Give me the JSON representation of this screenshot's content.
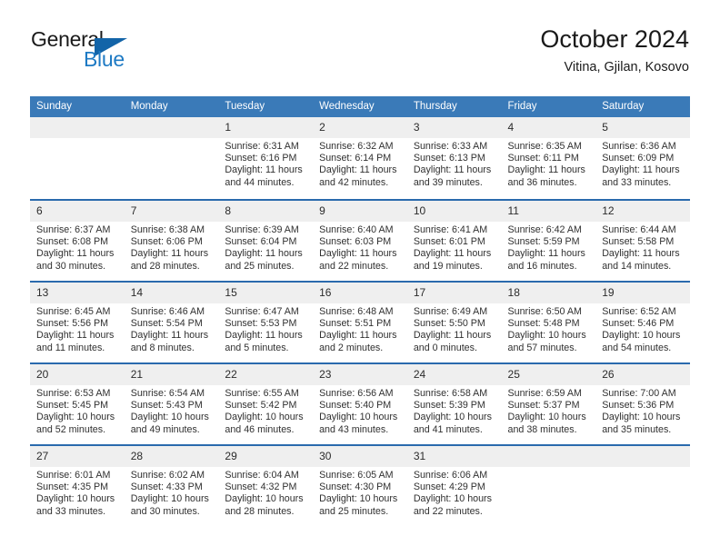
{
  "brand": {
    "word1": "General",
    "word2": "Blue",
    "triangle_color": "#1364a8",
    "blue_text_color": "#1e7ac4"
  },
  "header": {
    "title": "October 2024",
    "subtitle": "Vitina, Gjilan, Kosovo"
  },
  "theme": {
    "header_blue": "#3a7ab8",
    "row_divider_blue": "#2a6aad",
    "daynum_band": "#efefef"
  },
  "weekdays": [
    "Sunday",
    "Monday",
    "Tuesday",
    "Wednesday",
    "Thursday",
    "Friday",
    "Saturday"
  ],
  "weeks": [
    [
      {
        "day": ""
      },
      {
        "day": ""
      },
      {
        "day": "1",
        "sunrise": "Sunrise: 6:31 AM",
        "sunset": "Sunset: 6:16 PM",
        "daylight1": "Daylight: 11 hours",
        "daylight2": "and 44 minutes."
      },
      {
        "day": "2",
        "sunrise": "Sunrise: 6:32 AM",
        "sunset": "Sunset: 6:14 PM",
        "daylight1": "Daylight: 11 hours",
        "daylight2": "and 42 minutes."
      },
      {
        "day": "3",
        "sunrise": "Sunrise: 6:33 AM",
        "sunset": "Sunset: 6:13 PM",
        "daylight1": "Daylight: 11 hours",
        "daylight2": "and 39 minutes."
      },
      {
        "day": "4",
        "sunrise": "Sunrise: 6:35 AM",
        "sunset": "Sunset: 6:11 PM",
        "daylight1": "Daylight: 11 hours",
        "daylight2": "and 36 minutes."
      },
      {
        "day": "5",
        "sunrise": "Sunrise: 6:36 AM",
        "sunset": "Sunset: 6:09 PM",
        "daylight1": "Daylight: 11 hours",
        "daylight2": "and 33 minutes."
      }
    ],
    [
      {
        "day": "6",
        "sunrise": "Sunrise: 6:37 AM",
        "sunset": "Sunset: 6:08 PM",
        "daylight1": "Daylight: 11 hours",
        "daylight2": "and 30 minutes."
      },
      {
        "day": "7",
        "sunrise": "Sunrise: 6:38 AM",
        "sunset": "Sunset: 6:06 PM",
        "daylight1": "Daylight: 11 hours",
        "daylight2": "and 28 minutes."
      },
      {
        "day": "8",
        "sunrise": "Sunrise: 6:39 AM",
        "sunset": "Sunset: 6:04 PM",
        "daylight1": "Daylight: 11 hours",
        "daylight2": "and 25 minutes."
      },
      {
        "day": "9",
        "sunrise": "Sunrise: 6:40 AM",
        "sunset": "Sunset: 6:03 PM",
        "daylight1": "Daylight: 11 hours",
        "daylight2": "and 22 minutes."
      },
      {
        "day": "10",
        "sunrise": "Sunrise: 6:41 AM",
        "sunset": "Sunset: 6:01 PM",
        "daylight1": "Daylight: 11 hours",
        "daylight2": "and 19 minutes."
      },
      {
        "day": "11",
        "sunrise": "Sunrise: 6:42 AM",
        "sunset": "Sunset: 5:59 PM",
        "daylight1": "Daylight: 11 hours",
        "daylight2": "and 16 minutes."
      },
      {
        "day": "12",
        "sunrise": "Sunrise: 6:44 AM",
        "sunset": "Sunset: 5:58 PM",
        "daylight1": "Daylight: 11 hours",
        "daylight2": "and 14 minutes."
      }
    ],
    [
      {
        "day": "13",
        "sunrise": "Sunrise: 6:45 AM",
        "sunset": "Sunset: 5:56 PM",
        "daylight1": "Daylight: 11 hours",
        "daylight2": "and 11 minutes."
      },
      {
        "day": "14",
        "sunrise": "Sunrise: 6:46 AM",
        "sunset": "Sunset: 5:54 PM",
        "daylight1": "Daylight: 11 hours",
        "daylight2": "and 8 minutes."
      },
      {
        "day": "15",
        "sunrise": "Sunrise: 6:47 AM",
        "sunset": "Sunset: 5:53 PM",
        "daylight1": "Daylight: 11 hours",
        "daylight2": "and 5 minutes."
      },
      {
        "day": "16",
        "sunrise": "Sunrise: 6:48 AM",
        "sunset": "Sunset: 5:51 PM",
        "daylight1": "Daylight: 11 hours",
        "daylight2": "and 2 minutes."
      },
      {
        "day": "17",
        "sunrise": "Sunrise: 6:49 AM",
        "sunset": "Sunset: 5:50 PM",
        "daylight1": "Daylight: 11 hours",
        "daylight2": "and 0 minutes."
      },
      {
        "day": "18",
        "sunrise": "Sunrise: 6:50 AM",
        "sunset": "Sunset: 5:48 PM",
        "daylight1": "Daylight: 10 hours",
        "daylight2": "and 57 minutes."
      },
      {
        "day": "19",
        "sunrise": "Sunrise: 6:52 AM",
        "sunset": "Sunset: 5:46 PM",
        "daylight1": "Daylight: 10 hours",
        "daylight2": "and 54 minutes."
      }
    ],
    [
      {
        "day": "20",
        "sunrise": "Sunrise: 6:53 AM",
        "sunset": "Sunset: 5:45 PM",
        "daylight1": "Daylight: 10 hours",
        "daylight2": "and 52 minutes."
      },
      {
        "day": "21",
        "sunrise": "Sunrise: 6:54 AM",
        "sunset": "Sunset: 5:43 PM",
        "daylight1": "Daylight: 10 hours",
        "daylight2": "and 49 minutes."
      },
      {
        "day": "22",
        "sunrise": "Sunrise: 6:55 AM",
        "sunset": "Sunset: 5:42 PM",
        "daylight1": "Daylight: 10 hours",
        "daylight2": "and 46 minutes."
      },
      {
        "day": "23",
        "sunrise": "Sunrise: 6:56 AM",
        "sunset": "Sunset: 5:40 PM",
        "daylight1": "Daylight: 10 hours",
        "daylight2": "and 43 minutes."
      },
      {
        "day": "24",
        "sunrise": "Sunrise: 6:58 AM",
        "sunset": "Sunset: 5:39 PM",
        "daylight1": "Daylight: 10 hours",
        "daylight2": "and 41 minutes."
      },
      {
        "day": "25",
        "sunrise": "Sunrise: 6:59 AM",
        "sunset": "Sunset: 5:37 PM",
        "daylight1": "Daylight: 10 hours",
        "daylight2": "and 38 minutes."
      },
      {
        "day": "26",
        "sunrise": "Sunrise: 7:00 AM",
        "sunset": "Sunset: 5:36 PM",
        "daylight1": "Daylight: 10 hours",
        "daylight2": "and 35 minutes."
      }
    ],
    [
      {
        "day": "27",
        "sunrise": "Sunrise: 6:01 AM",
        "sunset": "Sunset: 4:35 PM",
        "daylight1": "Daylight: 10 hours",
        "daylight2": "and 33 minutes."
      },
      {
        "day": "28",
        "sunrise": "Sunrise: 6:02 AM",
        "sunset": "Sunset: 4:33 PM",
        "daylight1": "Daylight: 10 hours",
        "daylight2": "and 30 minutes."
      },
      {
        "day": "29",
        "sunrise": "Sunrise: 6:04 AM",
        "sunset": "Sunset: 4:32 PM",
        "daylight1": "Daylight: 10 hours",
        "daylight2": "and 28 minutes."
      },
      {
        "day": "30",
        "sunrise": "Sunrise: 6:05 AM",
        "sunset": "Sunset: 4:30 PM",
        "daylight1": "Daylight: 10 hours",
        "daylight2": "and 25 minutes."
      },
      {
        "day": "31",
        "sunrise": "Sunrise: 6:06 AM",
        "sunset": "Sunset: 4:29 PM",
        "daylight1": "Daylight: 10 hours",
        "daylight2": "and 22 minutes."
      },
      {
        "day": ""
      },
      {
        "day": ""
      }
    ]
  ]
}
